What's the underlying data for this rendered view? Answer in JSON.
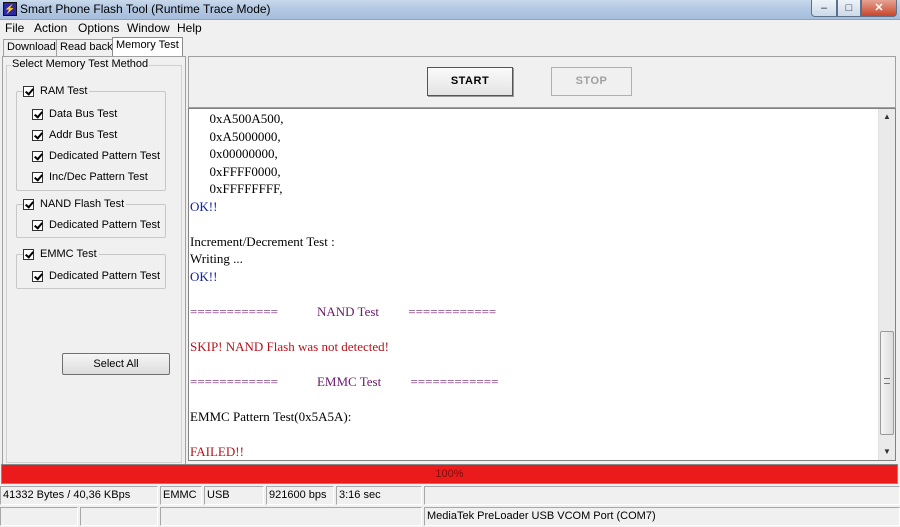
{
  "window": {
    "title": "Smart Phone Flash Tool (Runtime Trace Mode)",
    "app_icon": "flash-tool-icon",
    "controls": {
      "minimize": "–",
      "maximize": "□",
      "close": "✕"
    }
  },
  "menu": [
    "File",
    "Action",
    "Options",
    "Window",
    "Help"
  ],
  "tabs": [
    {
      "label": "Download",
      "active": false
    },
    {
      "label": "Read back",
      "active": false
    },
    {
      "label": "Memory Test",
      "active": true
    }
  ],
  "left_panel": {
    "group_title": "Select Memory Test Method",
    "ram": {
      "label": "RAM Test",
      "checked": true,
      "items": [
        "Data Bus Test",
        "Addr Bus Test",
        "Dedicated Pattern Test",
        "Inc/Dec Pattern Test"
      ]
    },
    "nand": {
      "label": "NAND Flash Test",
      "checked": true,
      "items": [
        "Dedicated Pattern Test"
      ]
    },
    "emmc": {
      "label": "EMMC Test",
      "checked": true,
      "items": [
        "Dedicated Pattern Test"
      ]
    },
    "select_all": "Select All"
  },
  "actions": {
    "start": "START",
    "stop": "STOP",
    "stop_enabled": false
  },
  "log": [
    {
      "text": "      0xA500A500,",
      "color": "black"
    },
    {
      "text": "      0xA5000000,",
      "color": "black"
    },
    {
      "text": "      0x00000000,",
      "color": "black"
    },
    {
      "text": "      0xFFFF0000,",
      "color": "black"
    },
    {
      "text": "      0xFFFFFFFF,",
      "color": "black"
    },
    {
      "text": "OK!!",
      "color": "blue"
    },
    {
      "text": "",
      "color": "black"
    },
    {
      "text": "Increment/Decrement Test :",
      "color": "black"
    },
    {
      "text": "Writing ...",
      "color": "black"
    },
    {
      "text": "OK!!",
      "color": "blue"
    },
    {
      "text": "",
      "color": "black"
    },
    {
      "text": "============            NAND Test         ============",
      "color": "purple"
    },
    {
      "text": "",
      "color": "black"
    },
    {
      "text": "SKIP! NAND Flash was not detected!",
      "color": "red"
    },
    {
      "text": "",
      "color": "black"
    },
    {
      "text": "============            EMMC Test         ============",
      "color": "purple"
    },
    {
      "text": "",
      "color": "black"
    },
    {
      "text": "EMMC Pattern Test(0x5A5A):",
      "color": "black"
    },
    {
      "text": "",
      "color": "black"
    },
    {
      "text": "FAILED!!",
      "color": "red"
    }
  ],
  "progress": {
    "percent": 100,
    "label": "100%",
    "color": "#ec1b1b"
  },
  "status": {
    "transfer": "41332 Bytes / 40,36 KBps",
    "storage": "EMMC",
    "interface": "USB",
    "baud": "921600 bps",
    "time": "3:16 sec",
    "port": "MediaTek PreLoader USB VCOM Port (COM7)"
  }
}
